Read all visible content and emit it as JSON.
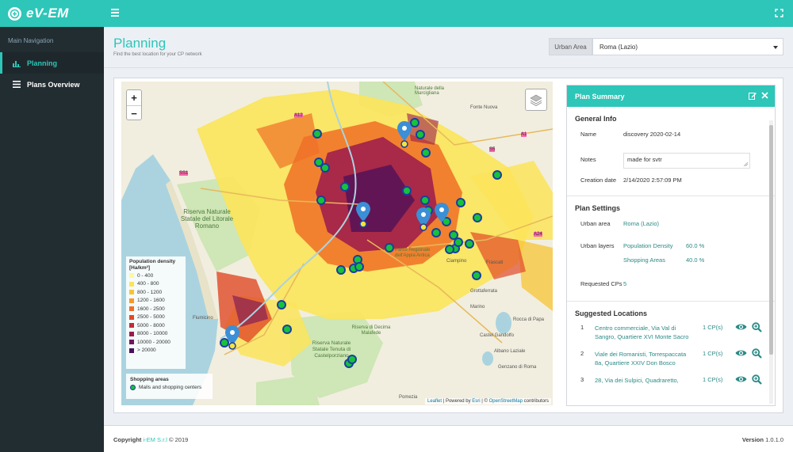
{
  "app": {
    "logo_text": "eV-EM"
  },
  "sidebar": {
    "header": "Main Navigation",
    "items": [
      {
        "label": "Planning",
        "icon": "chart-icon",
        "active": true
      },
      {
        "label": "Plans Overview",
        "icon": "list-icon",
        "active": false
      }
    ]
  },
  "header": {
    "title": "Planning",
    "subtitle": "Find the best location for your CP network",
    "urban_area_label": "Urban Area",
    "urban_area_value": "Roma (Lazio)"
  },
  "map": {
    "zoom_in": "+",
    "zoom_out": "−",
    "place_labels": {
      "riserva_litorale": "Riserva Naturale Statale del Litorale Romano",
      "riserva_castelporziano": "Riserva Naturale Statale Tenuta di Castelporziano",
      "riserva_decima": "Riserva di Decima Malafede",
      "fonte_nuova": "Fonte Nuova",
      "riserva_marcigliana": "Naturale della Marcigliana",
      "ciampino": "Ciampino",
      "frascati": "Frascati",
      "grottaferrata": "Grottaferrata",
      "rocca_di_papa": "Rocca di Papa",
      "marino": "Marino",
      "castel_gandolfo": "Castel Gandolfo",
      "albano_laziale": "Albano Laziale",
      "genzano": "Genzano di Roma",
      "fiumicino": "Fiumicino",
      "parco_appia": "Parco Regionale dell'Appia Antica",
      "pomezia": "Pomezia"
    },
    "road_labels": [
      "A1",
      "A24",
      "SS1",
      "A12",
      "S5"
    ],
    "legend": {
      "title_line1": "Population density",
      "title_line2": "[Ha/km²]",
      "classes": [
        {
          "label": "0 - 400",
          "color": "#fff7a0"
        },
        {
          "label": "400 - 800",
          "color": "#fbe45a"
        },
        {
          "label": "800 - 1200",
          "color": "#f7c437"
        },
        {
          "label": "1200 - 1600",
          "color": "#f39b2b"
        },
        {
          "label": "1600 - 2500",
          "color": "#ef6f26"
        },
        {
          "label": "2500 - 5000",
          "color": "#e14927"
        },
        {
          "label": "5000 - 8000",
          "color": "#c12a3a"
        },
        {
          "label": "8000 - 10000",
          "color": "#9b1a4c"
        },
        {
          "label": "10000 - 20000",
          "color": "#741459"
        },
        {
          "label": "> 20000",
          "color": "#4a0f5a"
        }
      ]
    },
    "shopping_legend": {
      "title": "Shopping areas",
      "item": "Malls and shopping centers"
    },
    "attribution": {
      "leaflet": "Leaflet",
      "mid": " | Powered by ",
      "esri": "Esri",
      "sep": " | © ",
      "osm": "OpenStreetMap",
      "tail": " contributors"
    }
  },
  "summary": {
    "title": "Plan Summary",
    "general_info_title": "General Info",
    "name_label": "Name",
    "name_value": "discovery 2020-02-14",
    "notes_label": "Notes",
    "notes_value": "made for svtr",
    "created_label": "Creation date",
    "created_value": "2/14/2020 2:57:09 PM",
    "settings_title": "Plan Settings",
    "urban_area_label": "Urban area",
    "urban_area_value": "Roma (Lazio)",
    "layers_label": "Urban layers",
    "layers": [
      {
        "name": "Population Density",
        "value": "60.0 %"
      },
      {
        "name": "Shopping Areas",
        "value": "40.0 %"
      }
    ],
    "requested_label": "Requested CPs",
    "requested_value": "5",
    "suggested_title": "Suggested Locations",
    "locations": [
      {
        "num": "1",
        "address": "Centro commerciale, Via Val di Sangro, Quartiere XVI Monte Sacro",
        "cps": "1 CP(s)"
      },
      {
        "num": "2",
        "address": "Viale dei Romanisti, Torrespaccata 8a, Quartiere XXIV Don Bosco",
        "cps": "1 CP(s)"
      },
      {
        "num": "3",
        "address": "28, Via dei Sulpici, Quadraretto,",
        "cps": "1 CP(s)"
      }
    ]
  },
  "footer": {
    "copyright_prefix": "Copyright ",
    "brand": "i-EM S.r.l",
    "copyright_suffix": " © 2019",
    "version_label": "Version",
    "version_value": "1.0.1.0"
  }
}
